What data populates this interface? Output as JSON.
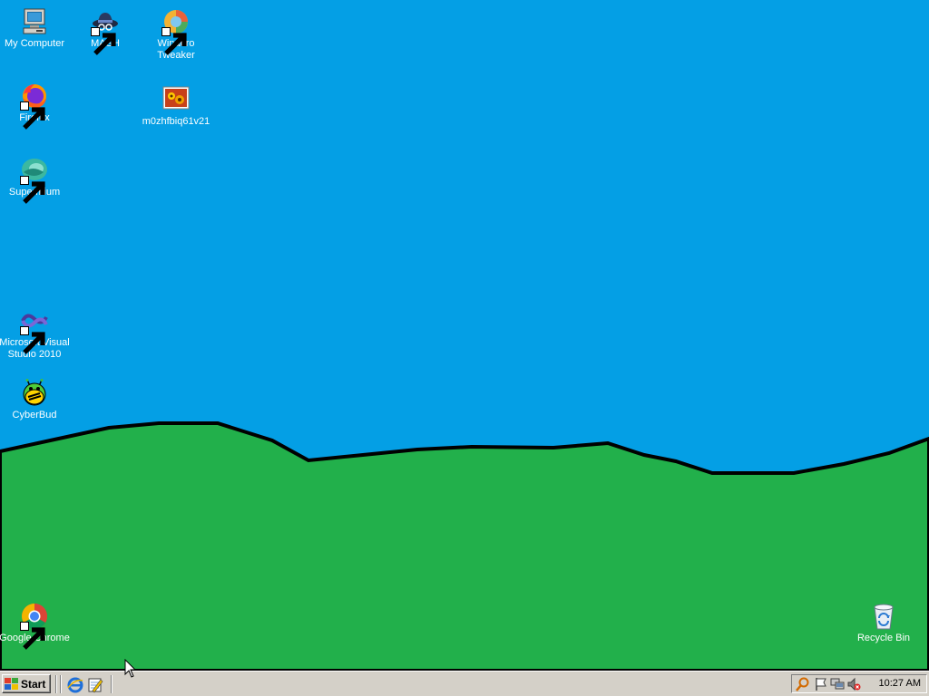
{
  "desktop": {
    "colors": {
      "sky": "#049fe5",
      "hill": "#22b04b",
      "hill_outline": "#000000"
    },
    "icons": [
      {
        "label": "My Computer",
        "icon": "computer-icon",
        "shortcut": false
      },
      {
        "label": "MASH",
        "icon": "spy-hat-icon",
        "shortcut": true
      },
      {
        "label": "Winaero Tweaker",
        "icon": "winaero-tweaker-icon",
        "shortcut": true
      },
      {
        "label": "Firefox",
        "icon": "firefox-icon",
        "shortcut": true
      },
      {
        "label": "m0zhfbiq61v21",
        "icon": "image-file-icon",
        "shortcut": false
      },
      {
        "label": "Supermium",
        "icon": "supermium-icon",
        "shortcut": true
      },
      {
        "label": "Microsoft Visual Studio 2010",
        "icon": "visual-studio-icon",
        "shortcut": true
      },
      {
        "label": "CyberBud",
        "icon": "cyberbud-icon",
        "shortcut": false
      },
      {
        "label": "Google Chrome",
        "icon": "chrome-icon",
        "shortcut": true
      },
      {
        "label": "Recycle Bin",
        "icon": "recycle-bin-icon",
        "shortcut": false
      }
    ]
  },
  "taskbar": {
    "start_label": "Start",
    "quick_launch": [
      {
        "icon": "internet-explorer-icon"
      },
      {
        "icon": "notepad-icon"
      }
    ],
    "tray": {
      "icons": [
        "search-icon",
        "flag-icon",
        "network-icon",
        "volume-muted-icon"
      ],
      "clock": "10:27 AM"
    }
  }
}
